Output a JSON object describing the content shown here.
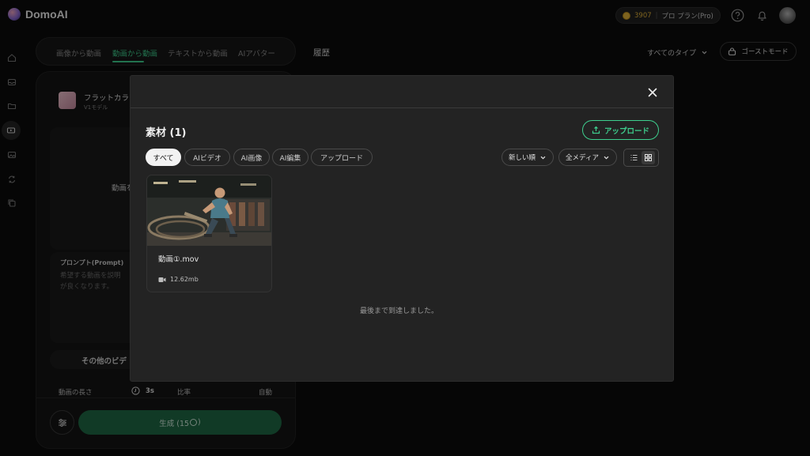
{
  "app": {
    "name": "DomoAI"
  },
  "header": {
    "credits": "3907",
    "plan": "プロ プラン(Pro)",
    "icons": [
      "help-icon",
      "bell-icon"
    ]
  },
  "mode_tabs": [
    {
      "label": "画像から動画",
      "active": false
    },
    {
      "label": "動画から動画",
      "active": true
    },
    {
      "label": "テキストから動画",
      "active": false
    },
    {
      "label": "AIアバター",
      "active": false
    }
  ],
  "history_label": "履歴",
  "type_filter": "すべてのタイプ",
  "ghost_mode": "ゴーストモード",
  "panel": {
    "model_name": "フラットカラ",
    "model_sub": "V1モデル",
    "upload_label": "動画を",
    "prompt_title": "プロンプト(Prompt)",
    "prompt_placeholder": "希望する動画を説明\nが良くなります。",
    "other_video": "その他のビデ",
    "duration_label": "動画の長さ",
    "duration_value": "3s",
    "ratio_label": "比率",
    "ratio_value": "自動",
    "generate_label": "生成 (15",
    "generate_suffix": ")"
  },
  "modal": {
    "title": "素材 (1)",
    "upload_button": "アップロード",
    "filters": [
      {
        "label": "すべて",
        "active": true
      },
      {
        "label": "AIビデオ",
        "active": false
      },
      {
        "label": "AI画像",
        "active": false
      },
      {
        "label": "AI編集",
        "active": false
      },
      {
        "label": "アップロード",
        "active": false
      }
    ],
    "sort": "新しい順",
    "media": "全メディア",
    "view_mode": "grid",
    "items": [
      {
        "name": "動画①.mov",
        "size": "12.62mb",
        "kind": "video"
      }
    ],
    "end_message": "最後まで到達しました。"
  },
  "colors": {
    "accent": "#3ecf8e",
    "background": "#0b0b0b",
    "modal": "#232323"
  }
}
